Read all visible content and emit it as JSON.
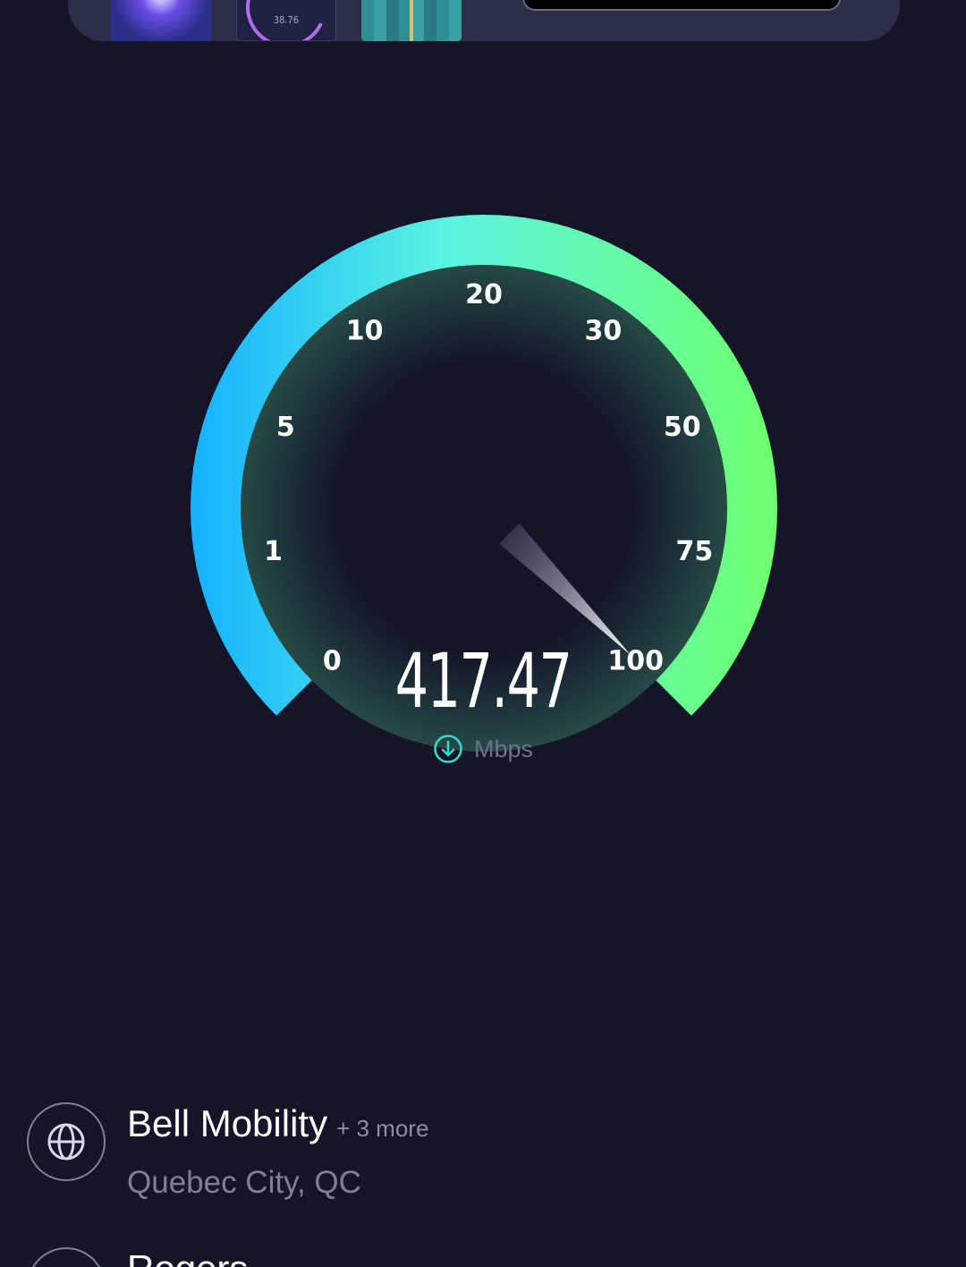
{
  "banner": {
    "thumbnail_2_value": "38.76"
  },
  "gauge": {
    "ticks": [
      "0",
      "1",
      "5",
      "10",
      "20",
      "30",
      "50",
      "75",
      "100"
    ],
    "needle_value": "100",
    "colors": {
      "start": "#14b1ff",
      "mid": "#5cf5e0",
      "end": "#6dff6d",
      "background": "#141528"
    }
  },
  "result": {
    "speed": "417.47",
    "unit": "Mbps",
    "direction_icon": "download-icon"
  },
  "servers": [
    {
      "name": "Bell Mobility",
      "more": "+ 3 more",
      "location": "Quebec City, QC",
      "icon": "globe-icon"
    },
    {
      "name": "Rogers",
      "icon": "globe-icon"
    }
  ]
}
